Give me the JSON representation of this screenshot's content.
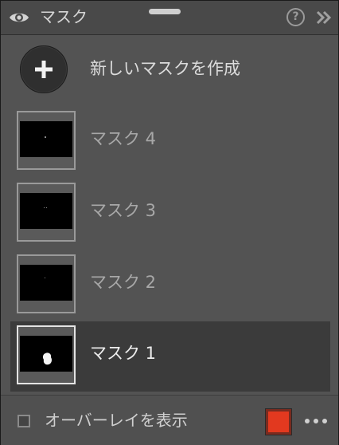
{
  "header": {
    "title": "マスク",
    "help_symbol": "?",
    "icons": [
      "eye-icon",
      "help-icon",
      "double-chevron-right-icon"
    ]
  },
  "new_mask": {
    "label": "新しいマスクを作成",
    "icon": "plus-icon"
  },
  "masks": [
    {
      "label": "マスク 4",
      "selected": false
    },
    {
      "label": "マスク 3",
      "selected": false
    },
    {
      "label": "マスク 2",
      "selected": false
    },
    {
      "label": "マスク 1",
      "selected": true
    }
  ],
  "footer": {
    "overlay_label": "オーバーレイを表示",
    "overlay_checked": false,
    "overlay_color": "#e2391f",
    "more_icon": "more-horizontal-icon"
  },
  "colors": {
    "panel_bg": "#535353",
    "selected_row_bg": "#3b3b3b"
  }
}
